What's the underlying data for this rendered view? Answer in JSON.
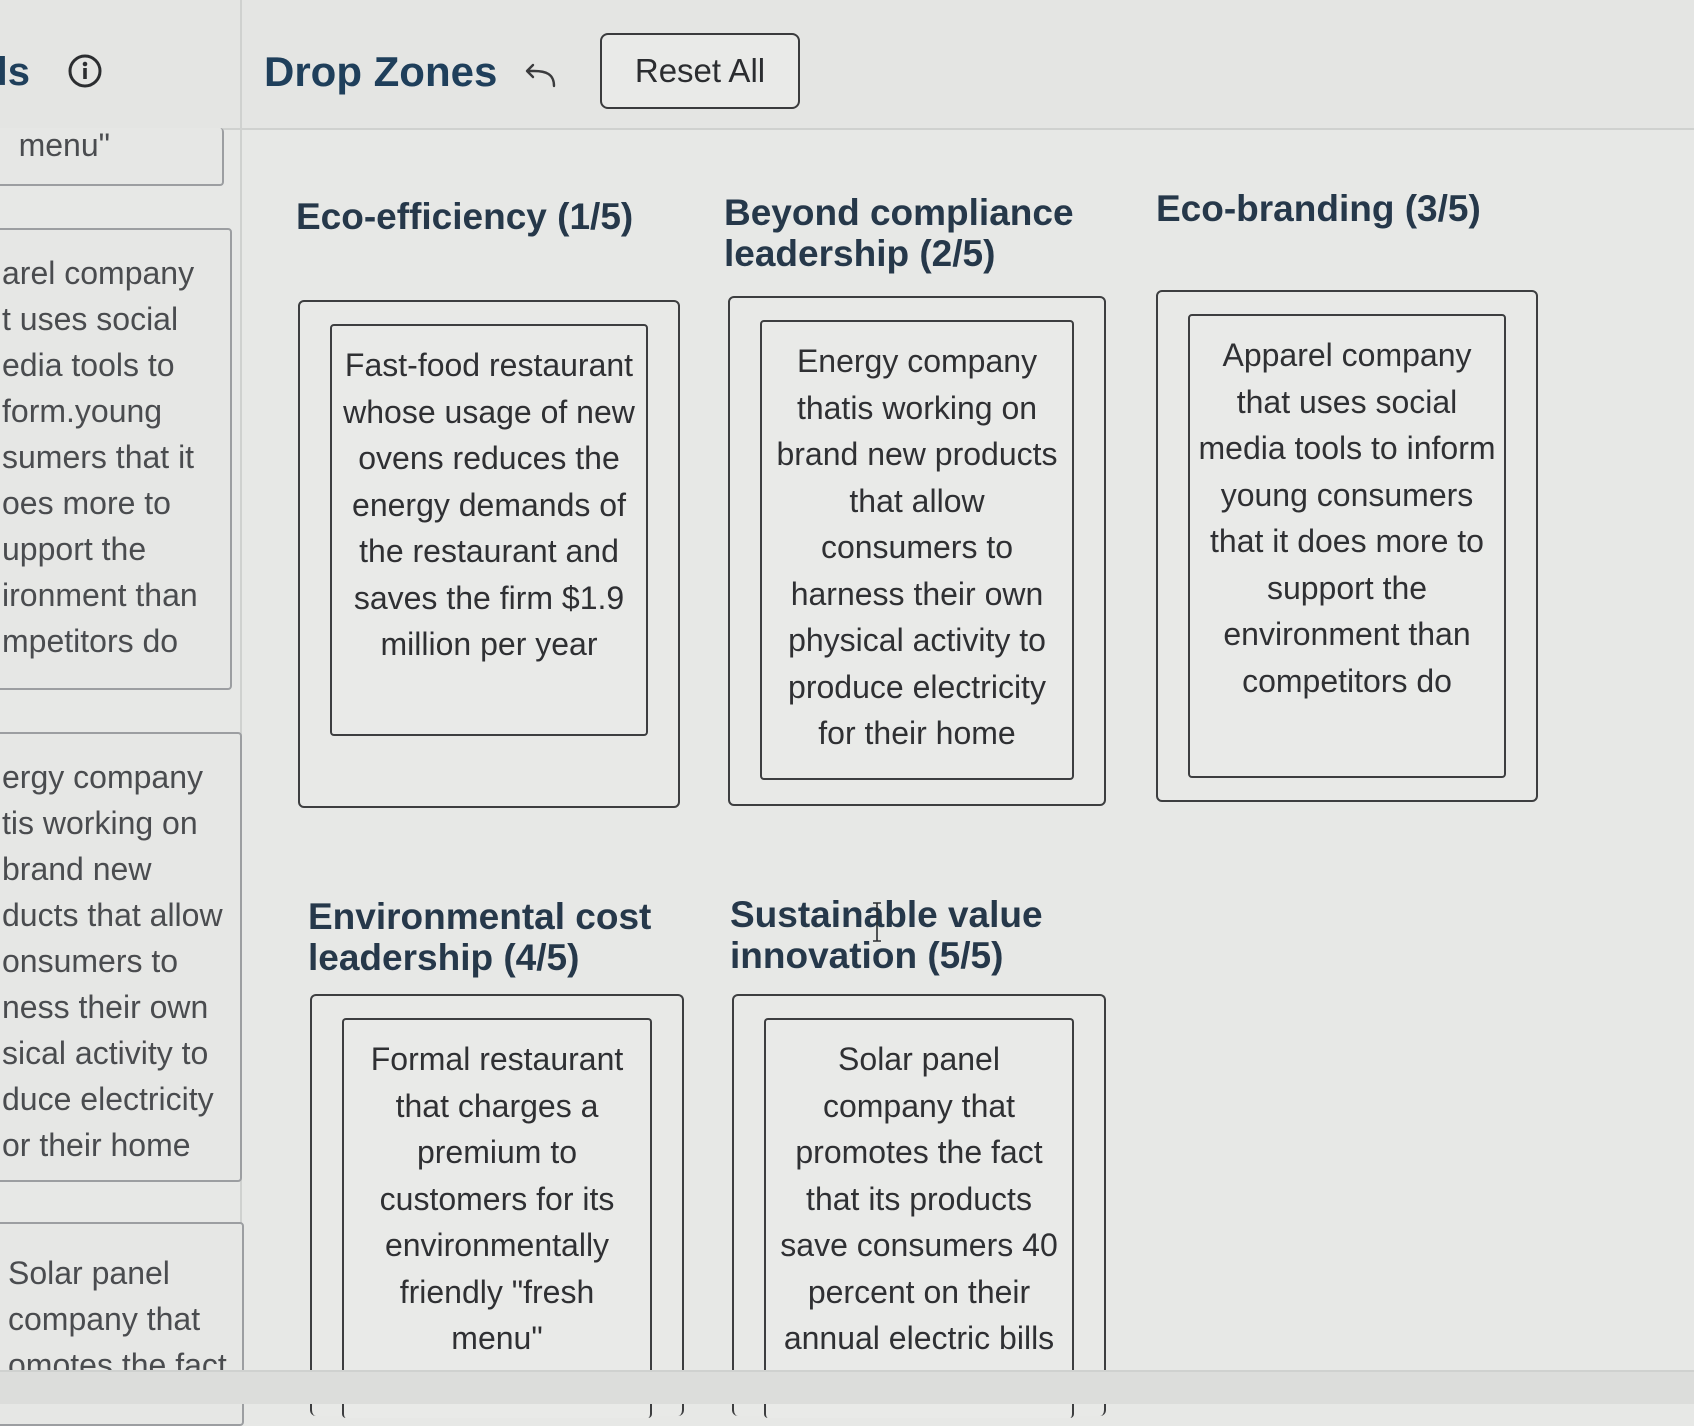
{
  "header": {
    "left_title": "ls",
    "zones_title": "Drop Zones",
    "reset_label": "Reset All"
  },
  "pool": {
    "card_fragment_top": "menu\"",
    "card_apparel": "arel company\nt uses social\nedia tools to\nform.young\nsumers that it\noes more to\nupport the\nironment than\nmpetitors do",
    "card_energy": "ergy company\ntis working on\nbrand new\nducts that allow\nonsumers to\nness their own\nsical activity to\nduce electricity\nor their home",
    "card_solar": "Solar panel\ncompany that\nomotes the fact"
  },
  "zones": [
    {
      "heading": "Eco-efficiency (1/5)",
      "card": "Fast-food restaurant whose usage of new ovens reduces the energy demands of the restaurant and saves the firm $1.9 million per year"
    },
    {
      "heading": "Beyond compliance leadership (2/5)",
      "card": "Energy company thatis working on brand new products that allow consumers to harness their own physical activity to produce electricity for their home"
    },
    {
      "heading": "Eco-branding (3/5)",
      "card": "Apparel company that uses social media tools to inform young consumers that it does more to support the environment than competitors do"
    },
    {
      "heading": "Environmental cost leadership (4/5)",
      "card": "Formal restaurant that charges a premium to customers for its environmentally friendly \"fresh menu\""
    },
    {
      "heading": "Sustainable value innovation (5/5)",
      "card": "Solar panel company that promotes the fact that its products save consumers 40 percent on their annual electric bills"
    }
  ]
}
